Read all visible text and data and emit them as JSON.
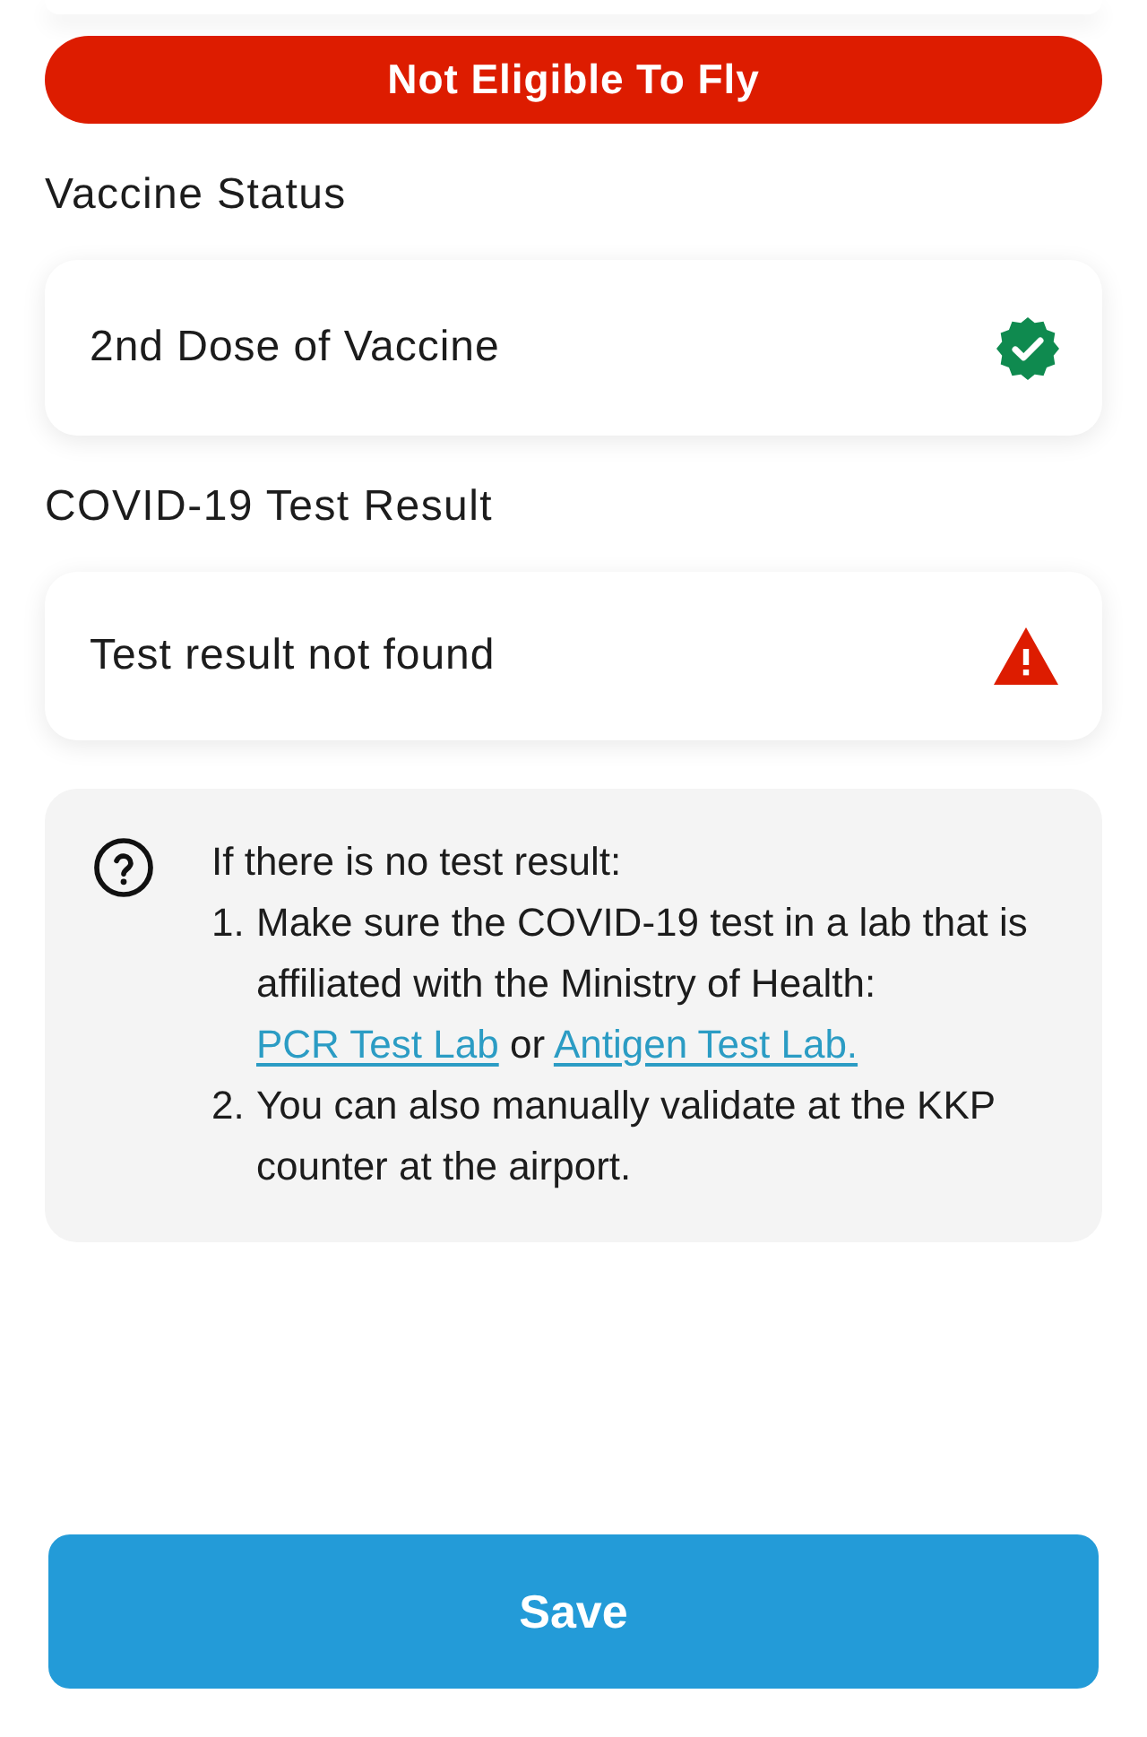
{
  "status_banner": {
    "text": "Not Eligible To Fly",
    "eligible": false
  },
  "sections": [
    {
      "heading": "Vaccine Status",
      "card": {
        "text": "2nd Dose of Vaccine",
        "kind": "verified"
      }
    },
    {
      "heading": "COVID-19 Test Result",
      "card": {
        "text": "Test result not found",
        "kind": "warning"
      }
    }
  ],
  "help_box": {
    "intro": "If there is no test result:",
    "steps": [
      {
        "number": "1.",
        "parts": [
          {
            "kind": "text",
            "text": "Make sure the COVID-19 test in a lab that is affiliated with the Ministry of Health:"
          },
          {
            "kind": "link",
            "text": "PCR Test Lab"
          },
          {
            "kind": "text",
            "text": "or"
          },
          {
            "kind": "link",
            "text": "Antigen Test Lab."
          }
        ]
      },
      {
        "number": "2.",
        "parts": [
          {
            "kind": "text",
            "text": "You can also manually validate at the KKP counter at the airport."
          }
        ]
      }
    ]
  },
  "save_button": {
    "label": "Save"
  }
}
